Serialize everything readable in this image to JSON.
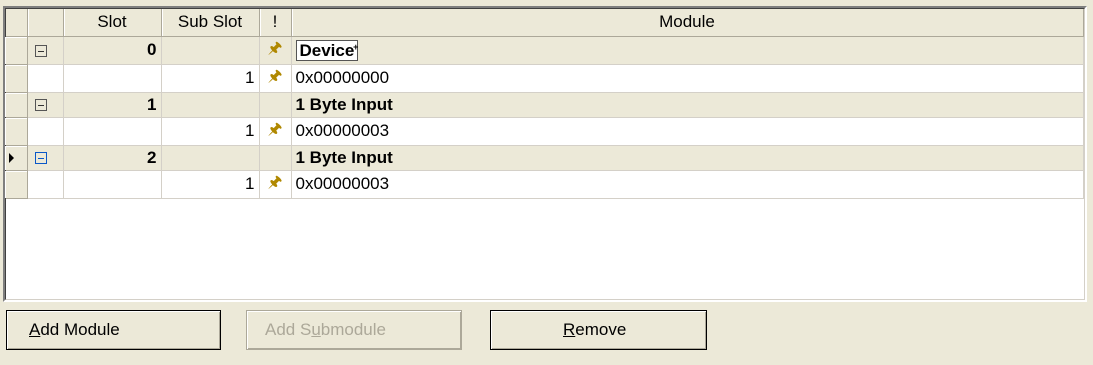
{
  "table": {
    "columns": [
      "",
      "",
      "Slot",
      "Sub Slot",
      "!",
      "Module"
    ],
    "rows": [
      {
        "type": "slot",
        "slot": "0",
        "subslot": "",
        "flag": true,
        "module": "Device",
        "editing": true,
        "current": false
      },
      {
        "type": "sub",
        "slot": "",
        "subslot": "1",
        "flag": true,
        "module": "0x00000000"
      },
      {
        "type": "slot",
        "slot": "1",
        "subslot": "",
        "flag": false,
        "module": "1 Byte Input",
        "current": false
      },
      {
        "type": "sub",
        "slot": "",
        "subslot": "1",
        "flag": true,
        "module": "0x00000003"
      },
      {
        "type": "slot",
        "slot": "2",
        "subslot": "",
        "flag": false,
        "module": "1 Byte Input",
        "current": true
      },
      {
        "type": "sub",
        "slot": "",
        "subslot": "1",
        "flag": true,
        "module": "0x00000003"
      }
    ]
  },
  "buttons": {
    "add_module": "Add Module",
    "add_module_mnemonic": "A",
    "add_submodule": "Add Submodule",
    "add_submodule_mnemonic": "u",
    "remove": "Remove",
    "remove_mnemonic": "R"
  },
  "icons": {
    "flag": "pin-icon",
    "expand": "collapse-icon",
    "row_pointer": "current-row-arrow-icon"
  },
  "colors": {
    "face": "#ece9d8",
    "pin": "#b08800",
    "focus_expander": "#0a58c8"
  }
}
